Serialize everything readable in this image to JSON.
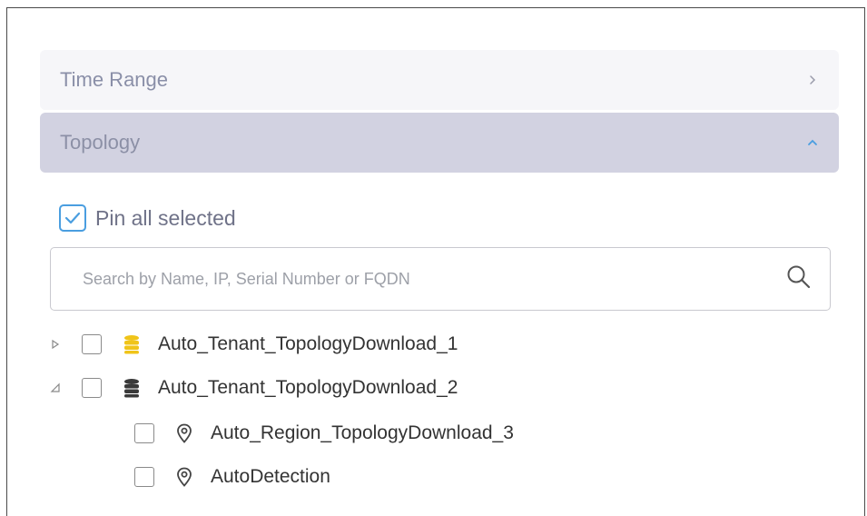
{
  "accordion": {
    "time_range": {
      "label": "Time Range",
      "state": "collapsed"
    },
    "topology": {
      "label": "Topology",
      "state": "expanded"
    }
  },
  "pin": {
    "label": "Pin all selected",
    "checked": true
  },
  "search": {
    "placeholder": "Search by Name, IP, Serial Number or FQDN",
    "value": ""
  },
  "tree": [
    {
      "label": "Auto_Tenant_TopologyDownload_1",
      "icon": "database-icon",
      "icon_color": "#f0c419",
      "expanded": false,
      "checked": false
    },
    {
      "label": "Auto_Tenant_TopologyDownload_2",
      "icon": "database-icon",
      "icon_color": "#3a3a3a",
      "expanded": true,
      "checked": false
    },
    {
      "label": "Auto_Region_TopologyDownload_3",
      "icon": "location-pin-icon",
      "checked": false
    },
    {
      "label": "AutoDetection",
      "icon": "location-pin-icon",
      "checked": false
    }
  ],
  "colors": {
    "accent": "#4a9ee0",
    "accordion_active_bg": "#d2d2e1",
    "accordion_inactive_bg": "#f6f6f9"
  }
}
